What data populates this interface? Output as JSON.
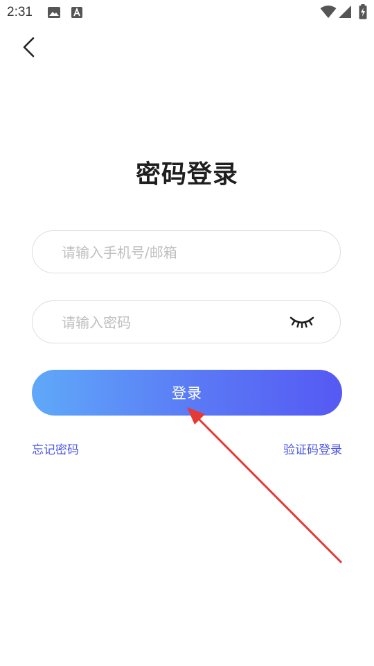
{
  "status_bar": {
    "time": "2:31",
    "icons": [
      "image-icon",
      "a-badge-icon",
      "wifi-icon",
      "signal-icon",
      "battery-charging-icon"
    ]
  },
  "nav": {
    "back_icon": "chevron-left-icon"
  },
  "title": "密码登录",
  "form": {
    "account": {
      "placeholder": "请输入手机号/邮箱",
      "value": ""
    },
    "password": {
      "placeholder": "请输入密码",
      "value": "",
      "toggle_icon": "eye-closed-icon"
    },
    "login_button": "登录"
  },
  "links": {
    "forgot_password": "忘记密码",
    "code_login": "验证码登录"
  },
  "colors": {
    "accent_link": "#4a55e6",
    "button_gradient_start": "#5fa9f9",
    "button_gradient_end": "#5559f3",
    "annotation_arrow": "#e53935"
  }
}
